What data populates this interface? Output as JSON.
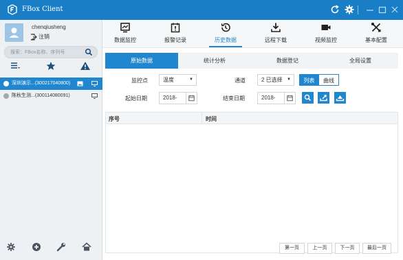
{
  "app": {
    "title": "FBox Client"
  },
  "user": {
    "name": "chenqiusheng",
    "logout_label": "注销"
  },
  "search": {
    "placeholder": "搜索：FBox名称、序列号"
  },
  "devices": [
    {
      "label": "深圳演示...(300217040800)",
      "active": true
    },
    {
      "label": "陈秋生测...(300114080091)",
      "active": false
    }
  ],
  "nav": [
    {
      "label": "数据监控",
      "icon": "monitor-icon"
    },
    {
      "label": "报警记录",
      "icon": "alarm-record-icon"
    },
    {
      "label": "历史数据",
      "icon": "history-icon",
      "active": true
    },
    {
      "label": "远程下载",
      "icon": "download-icon"
    },
    {
      "label": "视频监控",
      "icon": "video-camera-icon"
    },
    {
      "label": "基本配置",
      "icon": "tools-icon"
    }
  ],
  "subtabs": [
    {
      "label": "原始数据",
      "active": true
    },
    {
      "label": "统计分析"
    },
    {
      "label": "数据登记"
    },
    {
      "label": "全局设置"
    }
  ],
  "form": {
    "monitor_point_label": "监控点",
    "monitor_point_value": "温度",
    "channel_label": "通道",
    "channel_value": "2 已选择",
    "view_list": "列表",
    "view_curve": "曲线",
    "start_label": "起始日期",
    "start_value": "2018-",
    "end_label": "结束日期",
    "end_value": "2018-"
  },
  "table": {
    "col_seq": "序号",
    "col_time": "时间"
  },
  "pager": {
    "first": "第一页",
    "prev": "上一页",
    "next": "下一页",
    "last": "最后一页"
  },
  "colors": {
    "accent": "#1f86cf",
    "titlebar": "#1a7ec7"
  }
}
